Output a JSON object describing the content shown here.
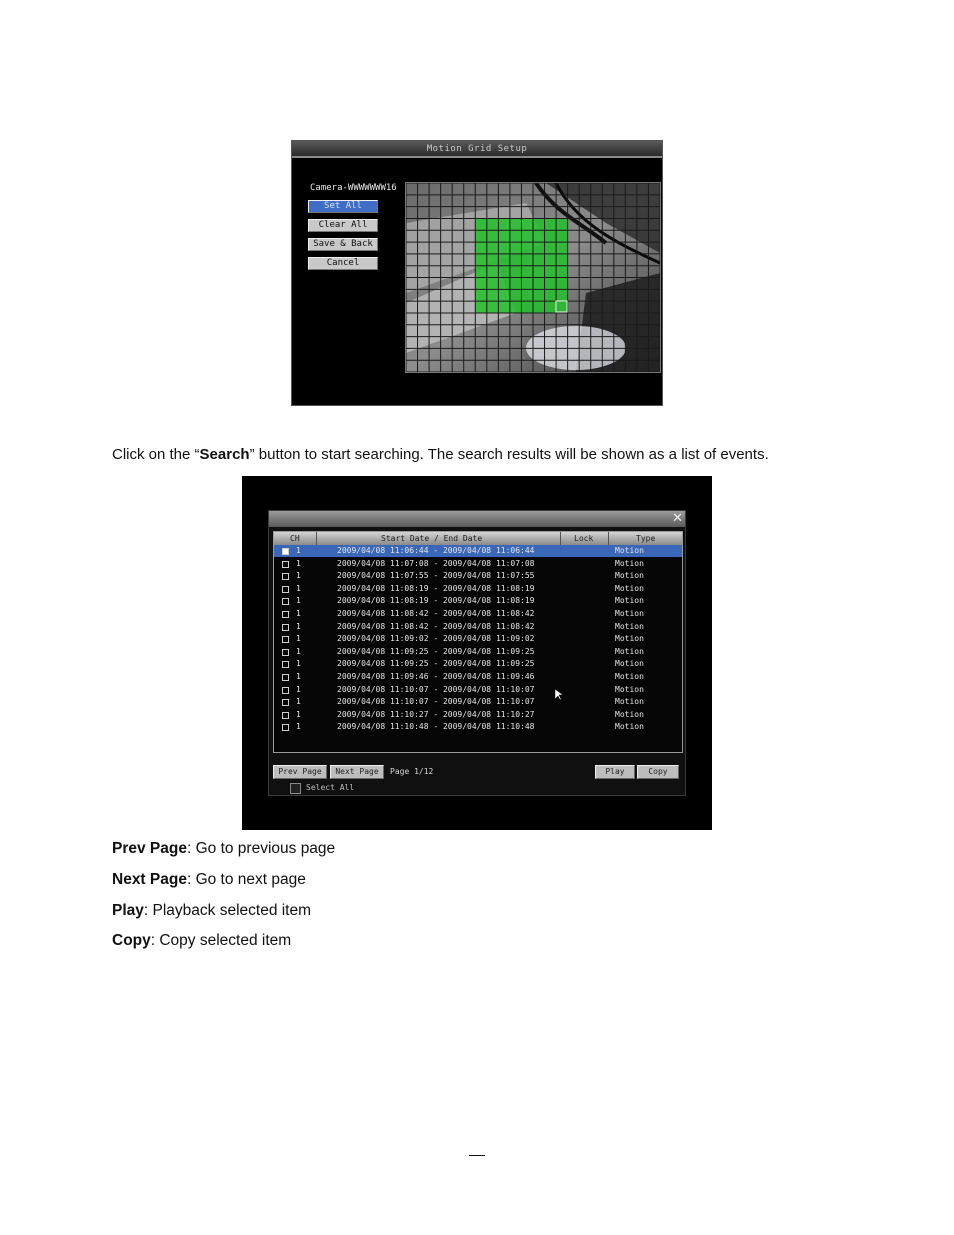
{
  "motion_grid": {
    "title": "Motion Grid Setup",
    "camera_name": "Camera-WWWWWWW16",
    "buttons": {
      "set_all": "Set All",
      "clear_all": "Clear All",
      "save_back": "Save & Back",
      "cancel": "Cancel"
    },
    "grid": {
      "columns": 22,
      "rows": 16,
      "selected_area_color": "#22c12a"
    }
  },
  "paragraph": {
    "before": "Click on the “",
    "bold": "Search",
    "after": "” button to start searching. The search results will be shown as a list of events."
  },
  "search_results": {
    "columns": {
      "ch": "CH",
      "date": "Start Date / End Date",
      "lock": "Lock",
      "type": "Type"
    },
    "rows": [
      {
        "ch": "1",
        "dates": "2009/04/08  11:06:44 - 2009/04/08  11:06:44",
        "type": "Motion",
        "selected": true
      },
      {
        "ch": "1",
        "dates": "2009/04/08  11:07:08 - 2009/04/08  11:07:08",
        "type": "Motion"
      },
      {
        "ch": "1",
        "dates": "2009/04/08  11:07:55 - 2009/04/08  11:07:55",
        "type": "Motion"
      },
      {
        "ch": "1",
        "dates": "2009/04/08  11:08:19 - 2009/04/08  11:08:19",
        "type": "Motion"
      },
      {
        "ch": "1",
        "dates": "2009/04/08  11:08:19 - 2009/04/08  11:08:19",
        "type": "Motion"
      },
      {
        "ch": "1",
        "dates": "2009/04/08  11:08:42 - 2009/04/08  11:08:42",
        "type": "Motion"
      },
      {
        "ch": "1",
        "dates": "2009/04/08  11:08:42 - 2009/04/08  11:08:42",
        "type": "Motion"
      },
      {
        "ch": "1",
        "dates": "2009/04/08  11:09:02 - 2009/04/08  11:09:02",
        "type": "Motion"
      },
      {
        "ch": "1",
        "dates": "2009/04/08  11:09:25 - 2009/04/08  11:09:25",
        "type": "Motion"
      },
      {
        "ch": "1",
        "dates": "2009/04/08  11:09:25 - 2009/04/08  11:09:25",
        "type": "Motion"
      },
      {
        "ch": "1",
        "dates": "2009/04/08  11:09:46 - 2009/04/08  11:09:46",
        "type": "Motion"
      },
      {
        "ch": "1",
        "dates": "2009/04/08  11:10:07 - 2009/04/08  11:10:07",
        "type": "Motion"
      },
      {
        "ch": "1",
        "dates": "2009/04/08  11:10:07 - 2009/04/08  11:10:07",
        "type": "Motion"
      },
      {
        "ch": "1",
        "dates": "2009/04/08  11:10:27 - 2009/04/08  11:10:27",
        "type": "Motion"
      },
      {
        "ch": "1",
        "dates": "2009/04/08  11:10:48 - 2009/04/08  11:10:48",
        "type": "Motion"
      }
    ],
    "buttons": {
      "prev_page": "Prev Page",
      "next_page": "Next Page",
      "play": "Play",
      "copy": "Copy"
    },
    "page_label": "Page 1/12",
    "select_all": "Select All",
    "close": "✕"
  },
  "definitions": [
    {
      "term": "Prev Page",
      "desc": ": Go to previous page"
    },
    {
      "term": "Next Page",
      "desc": ": Go to next page"
    },
    {
      "term": "Play",
      "desc": ": Playback selected item"
    },
    {
      "term": "Copy",
      "desc": ": Copy selected item"
    }
  ]
}
